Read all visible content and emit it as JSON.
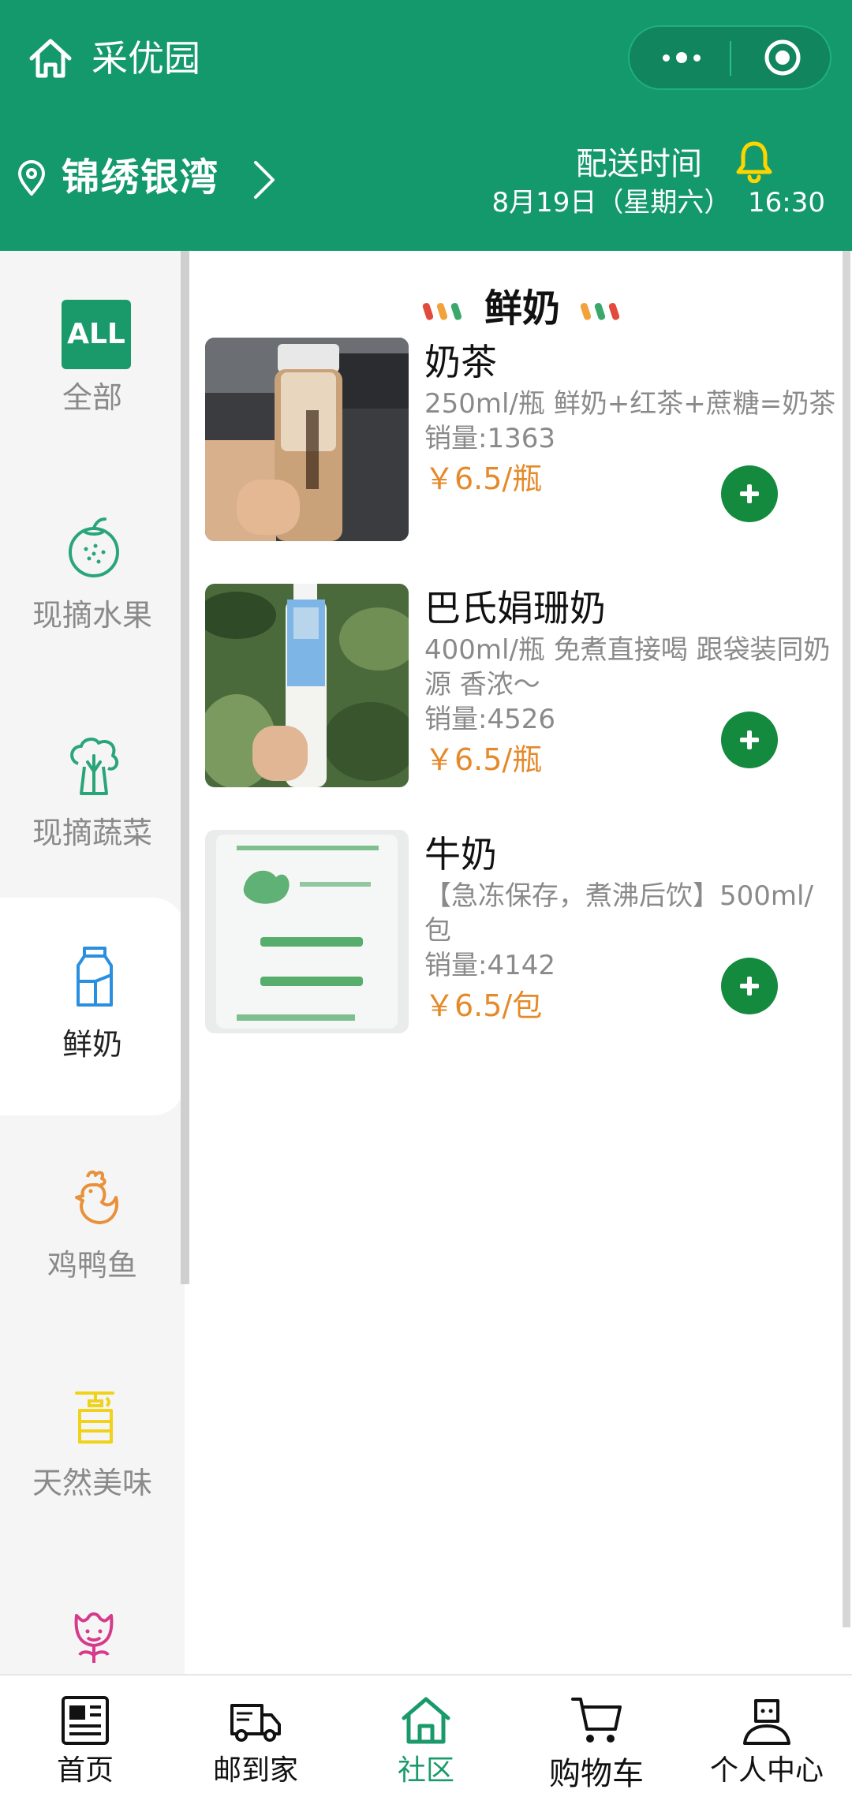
{
  "header": {
    "title": "采优园",
    "location": "锦绣银湾",
    "delivery_label": "配送时间",
    "delivery_time": "8月19日（星期六）  16:30"
  },
  "sidebar": {
    "items": [
      {
        "label": "全部",
        "icon": "all-badge-icon",
        "badge": "ALL"
      },
      {
        "label": "现摘水果",
        "icon": "fruit-icon"
      },
      {
        "label": "现摘蔬菜",
        "icon": "vegetable-icon"
      },
      {
        "label": "鲜奶",
        "icon": "milk-icon",
        "active": true
      },
      {
        "label": "鸡鸭鱼",
        "icon": "rooster-icon"
      },
      {
        "label": "天然美味",
        "icon": "honey-icon"
      },
      {
        "label": "",
        "icon": "flower-icon"
      }
    ]
  },
  "section": {
    "title": "鲜奶"
  },
  "products": [
    {
      "name": "奶茶",
      "desc": "250ml/瓶 鲜奶+红茶+蔗糖=奶茶",
      "sales": "销量:1363",
      "price": "￥6.5/瓶"
    },
    {
      "name": "巴氏娟珊奶",
      "desc": "400ml/瓶 免煮直接喝 跟袋装同奶源 香浓～",
      "sales": "销量:4526",
      "price": "￥6.5/瓶"
    },
    {
      "name": "牛奶",
      "desc": "【急冻保存，煮沸后饮】500ml/包",
      "sales": "销量:4142",
      "price": "￥6.5/包"
    }
  ],
  "tabbar": {
    "items": [
      {
        "label": "首页",
        "icon": "news-icon"
      },
      {
        "label": "邮到家",
        "icon": "truck-icon"
      },
      {
        "label": "社区",
        "icon": "community-home-icon",
        "active": true
      },
      {
        "label": "购物车",
        "icon": "cart-icon"
      },
      {
        "label": "个人中心",
        "icon": "user-icon"
      }
    ]
  },
  "colors": {
    "brand_green": "#14996c",
    "price_orange": "#e58a2a",
    "add_button": "#138a3d",
    "sidebar_bg": "#f5f5f5"
  }
}
